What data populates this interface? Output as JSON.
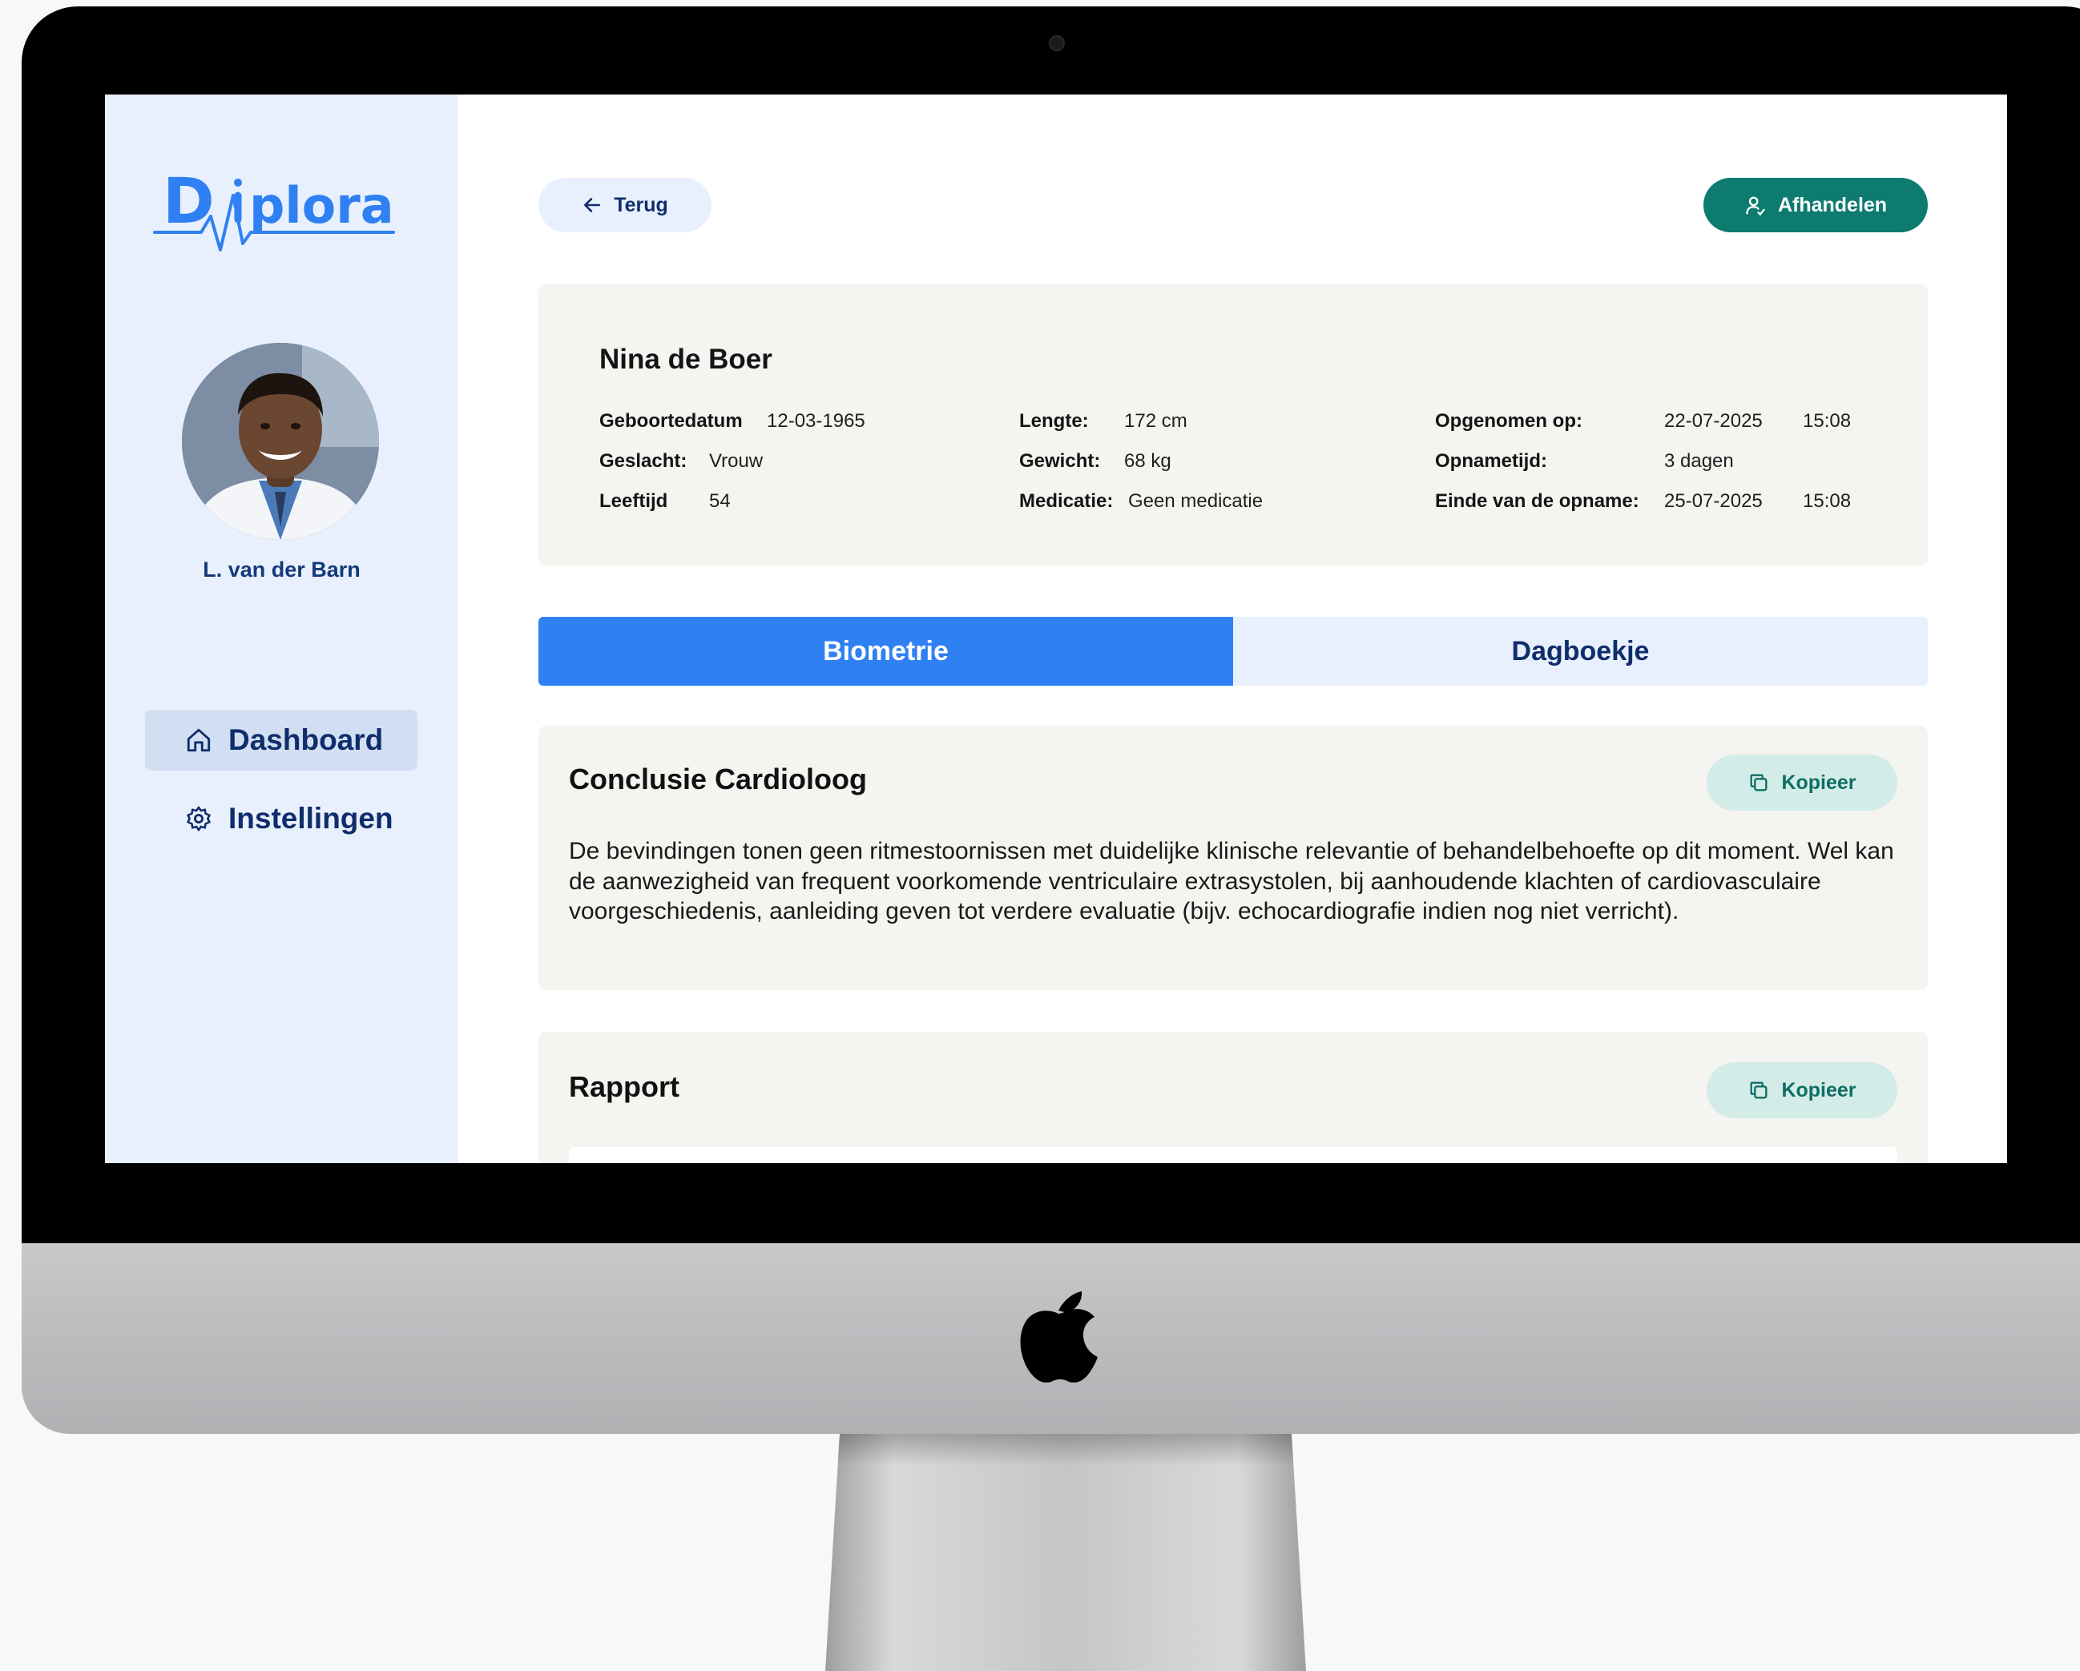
{
  "brand": {
    "name": "Diplora",
    "primary_color": "#2f80f3",
    "accent_color": "#0e7b71"
  },
  "sidebar": {
    "user_name": "L. van der Barn",
    "nav": [
      {
        "label": "Dashboard",
        "icon": "home-icon",
        "active": true
      },
      {
        "label": "Instellingen",
        "icon": "gear-icon",
        "active": false
      }
    ]
  },
  "header": {
    "back_label": "Terug",
    "action_label": "Afhandelen"
  },
  "patient": {
    "name": "Nina de Boer",
    "fields": {
      "dob_label": "Geboortedatum",
      "dob": "12-03-1965",
      "gender_label": "Geslacht:",
      "gender": "Vrouw",
      "age_label": "Leeftijd",
      "age": "54",
      "height_label": "Lengte:",
      "height": "172 cm",
      "weight_label": "Gewicht:",
      "weight": "68 kg",
      "medication_label": "Medicatie:",
      "medication": "Geen medicatie",
      "admitted_label": "Opgenomen op:",
      "admitted_date": "22-07-2025",
      "admitted_time": "15:08",
      "duration_label": "Opnametijd:",
      "duration": "3 dagen",
      "end_label": "Einde van de opname:",
      "end_date": "25-07-2025",
      "end_time": "15:08"
    }
  },
  "tabs": [
    {
      "label": "Biometrie",
      "active": true
    },
    {
      "label": "Dagboekje",
      "active": false
    }
  ],
  "sections": {
    "conclusion": {
      "title": "Conclusie Cardioloog",
      "copy_label": "Kopieer",
      "body": "De bevindingen tonen geen ritmestoornissen met duidelijke klinische relevantie of behandelbehoefte op dit moment. Wel kan de aanwezigheid van frequent voorkomende ventriculaire extrasystolen, bij aanhoudende klachten of cardiovasculaire voorgeschiedenis, aanleiding geven tot verdere evaluatie (bijv. echocardiografie indien nog niet verricht)."
    },
    "report": {
      "title": "Rapport",
      "copy_label": "Kopieer"
    }
  }
}
